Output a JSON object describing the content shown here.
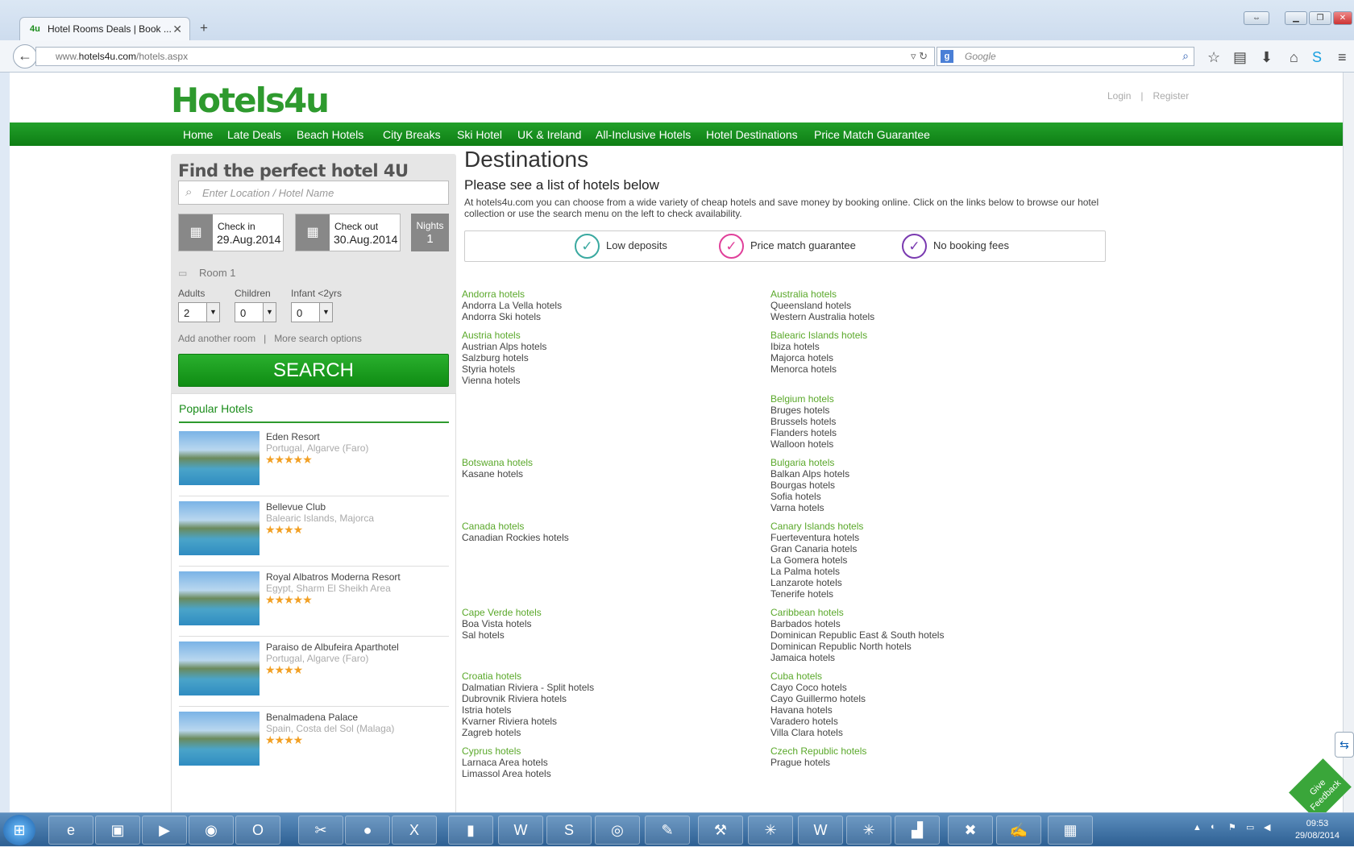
{
  "browser": {
    "tab_title": "Hotel Rooms Deals | Book ...",
    "tab_favicon": "4u",
    "url_prefix": "www.",
    "url_domain": "hotels4u.com",
    "url_path": "/hotels.aspx",
    "search_placeholder": "Google"
  },
  "site": {
    "logo": "Hotels4u",
    "login": "Login",
    "separator": "|",
    "register": "Register"
  },
  "nav": [
    "Home",
    "Late Deals",
    "Beach Hotels",
    "City Breaks",
    "Ski Hotel",
    "UK & Ireland",
    "All-Inclusive Hotels",
    "Hotel Destinations",
    "Price Match Guarantee"
  ],
  "search": {
    "title": "Find the perfect hotel 4U",
    "location_placeholder": "Enter Location / Hotel Name",
    "checkin_label": "Check in",
    "checkin_value": "29.Aug.2014",
    "checkout_label": "Check out",
    "checkout_value": "30.Aug.2014",
    "nights_label": "Nights",
    "nights_value": "1",
    "room_label": "Room 1",
    "adults_label": "Adults",
    "adults_value": "2",
    "children_label": "Children",
    "children_value": "0",
    "infant_label": "Infant <2yrs",
    "infant_value": "0",
    "add_room": "Add another room",
    "more_options": "More search options",
    "button": "SEARCH"
  },
  "popular": {
    "title": "Popular Hotels",
    "hotels": [
      {
        "name": "Eden Resort",
        "location": "Portugal, Algarve (Faro)",
        "stars": "★★★★★"
      },
      {
        "name": "Bellevue Club",
        "location": "Balearic Islands, Majorca",
        "stars": "★★★★"
      },
      {
        "name": "Royal Albatros Moderna Resort",
        "location": "Egypt, Sharm El Sheikh Area",
        "stars": "★★★★★"
      },
      {
        "name": "Paraiso de Albufeira Aparthotel",
        "location": "Portugal, Algarve (Faro)",
        "stars": "★★★★"
      },
      {
        "name": "Benalmadena Palace",
        "location": "Spain, Costa del Sol (Malaga)",
        "stars": "★★★★"
      }
    ]
  },
  "main": {
    "title": "Destinations",
    "subtitle": "Please see a list of hotels below",
    "description": "At hotels4u.com you can choose from a wide variety of cheap hotels and save money by booking online. Click on the links below to browse our hotel collection or use the search menu on the left to check availability.",
    "features": [
      {
        "label": "Low deposits",
        "color": "#3aa9a0"
      },
      {
        "label": "Price match guarantee",
        "color": "#e0409a"
      },
      {
        "label": "No booking fees",
        "color": "#7a3ab0"
      }
    ]
  },
  "countries_left": [
    {
      "head": "Andorra hotels",
      "subs": [
        "Andorra La Vella hotels",
        "Andorra Ski hotels"
      ]
    },
    {
      "head": "Austria hotels",
      "subs": [
        "Austrian Alps hotels",
        "Salzburg hotels",
        "Styria hotels",
        "Vienna hotels"
      ]
    },
    {
      "head": "Botswana hotels",
      "subs": [
        "Kasane hotels"
      ]
    },
    {
      "head": "Canada hotels",
      "subs": [
        "Canadian Rockies hotels"
      ]
    },
    {
      "head": "Cape Verde hotels",
      "subs": [
        "Boa Vista hotels",
        "Sal hotels"
      ]
    },
    {
      "head": "Croatia hotels",
      "subs": [
        "Dalmatian Riviera - Split hotels",
        "Dubrovnik Riviera hotels",
        "Istria hotels",
        "Kvarner Riviera hotels",
        "Zagreb hotels"
      ]
    },
    {
      "head": "Cyprus hotels",
      "subs": [
        "Larnaca Area hotels",
        "Limassol Area hotels"
      ]
    }
  ],
  "countries_right": [
    {
      "head": "Australia hotels",
      "subs": [
        "Queensland hotels",
        "Western Australia hotels"
      ]
    },
    {
      "head": "Balearic Islands hotels",
      "subs": [
        "Ibiza hotels",
        "Majorca hotels",
        "Menorca hotels"
      ]
    },
    {
      "head": "Belgium hotels",
      "subs": [
        "Bruges hotels",
        "Brussels hotels",
        "Flanders hotels",
        "Walloon hotels"
      ]
    },
    {
      "head": "Bulgaria hotels",
      "subs": [
        "Balkan Alps hotels",
        "Bourgas hotels",
        "Sofia hotels",
        "Varna hotels"
      ]
    },
    {
      "head": "Canary Islands hotels",
      "subs": [
        "Fuerteventura hotels",
        "Gran Canaria hotels",
        "La Gomera hotels",
        "La Palma hotels",
        "Lanzarote hotels",
        "Tenerife hotels"
      ]
    },
    {
      "head": "Caribbean hotels",
      "subs": [
        "Barbados hotels",
        "Dominican Republic East & South hotels",
        "Dominican Republic North hotels",
        "Jamaica hotels"
      ]
    },
    {
      "head": "Cuba hotels",
      "subs": [
        "Cayo Coco hotels",
        "Cayo Guillermo hotels",
        "Havana hotels",
        "Varadero hotels",
        "Villa Clara hotels"
      ]
    },
    {
      "head": "Czech Republic hotels",
      "subs": [
        "Prague hotels"
      ]
    }
  ],
  "feedback": "Give Feedback",
  "taskbar": {
    "time": "09:53",
    "date": "29/08/2014"
  }
}
